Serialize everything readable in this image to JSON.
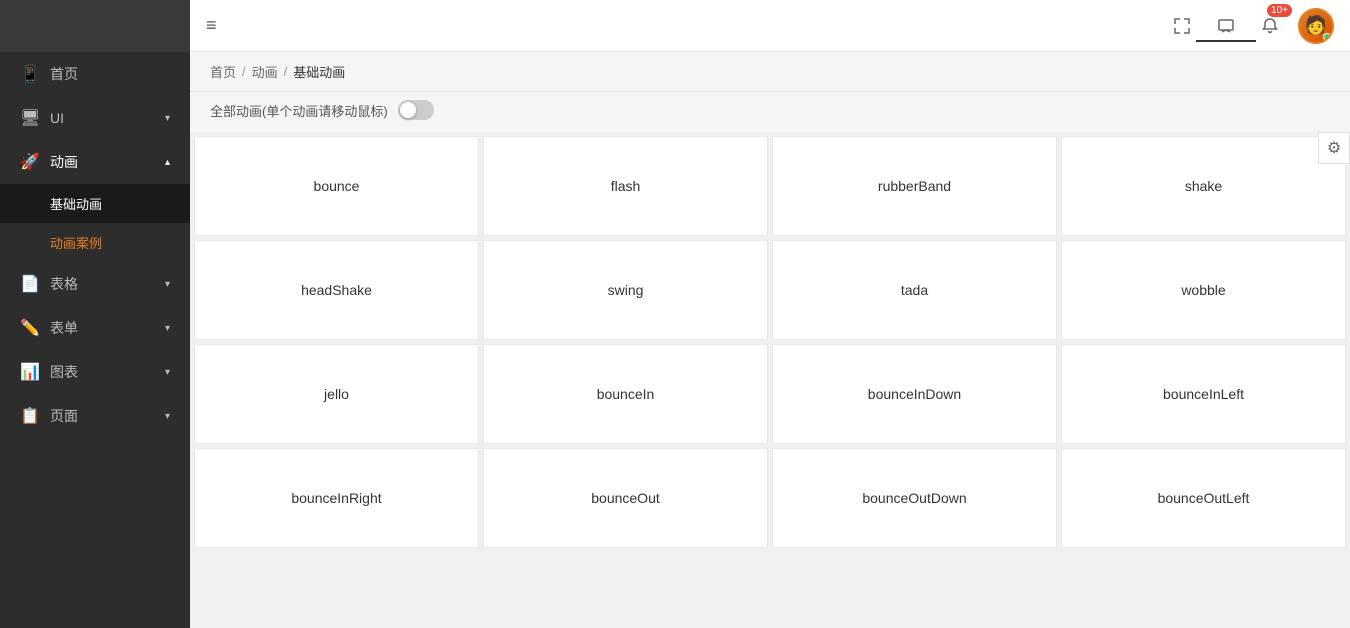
{
  "sidebar": {
    "logo_text": "",
    "items": [
      {
        "id": "home",
        "label": "首页",
        "icon": "📱",
        "has_chevron": false
      },
      {
        "id": "ui",
        "label": "UI",
        "icon": "🖥",
        "has_chevron": true
      },
      {
        "id": "animation",
        "label": "动画",
        "icon": "🚀",
        "has_chevron": true,
        "expanded": true,
        "sub_items": [
          {
            "id": "basic-animation",
            "label": "基础动画",
            "active": true
          },
          {
            "id": "animation-case",
            "label": "动画案例",
            "selected": true
          }
        ]
      },
      {
        "id": "table",
        "label": "表格",
        "icon": "📄",
        "has_chevron": true
      },
      {
        "id": "form",
        "label": "表单",
        "icon": "✏️",
        "has_chevron": true
      },
      {
        "id": "chart",
        "label": "图表",
        "icon": "📊",
        "has_chevron": true
      },
      {
        "id": "page",
        "label": "页面",
        "icon": "📋",
        "has_chevron": true
      }
    ]
  },
  "header": {
    "menu_icon": "≡",
    "fullscreen_icon": "⤢",
    "message_icon": "💬",
    "notification_badge": "10+",
    "active_tab_bottom_line": true
  },
  "breadcrumb": {
    "items": [
      {
        "label": "首页",
        "link": true
      },
      {
        "label": "动画",
        "link": true
      },
      {
        "label": "基础动画",
        "link": false
      }
    ],
    "separator": "/"
  },
  "toggle": {
    "label": "全部动画(单个动画请移动鼠标)",
    "enabled": false
  },
  "animations": {
    "cards": [
      {
        "id": "bounce",
        "label": "bounce"
      },
      {
        "id": "flash",
        "label": "flash"
      },
      {
        "id": "rubberBand",
        "label": "rubberBand"
      },
      {
        "id": "shake",
        "label": "shake"
      },
      {
        "id": "headShake",
        "label": "headShake"
      },
      {
        "id": "swing",
        "label": "swing"
      },
      {
        "id": "tada",
        "label": "tada"
      },
      {
        "id": "wobble",
        "label": "wobble"
      },
      {
        "id": "jello",
        "label": "jello"
      },
      {
        "id": "bounceIn",
        "label": "bounceIn"
      },
      {
        "id": "bounceInDown",
        "label": "bounceInDown"
      },
      {
        "id": "bounceInLeft",
        "label": "bounceInLeft"
      },
      {
        "id": "bounceInRight",
        "label": "bounceInRight"
      },
      {
        "id": "bounceOut",
        "label": "bounceOut"
      },
      {
        "id": "bounceOutDown",
        "label": "bounceOutDown"
      },
      {
        "id": "bounceOutLeft",
        "label": "bounceOutLeft"
      }
    ]
  },
  "settings": {
    "icon": "⚙"
  }
}
